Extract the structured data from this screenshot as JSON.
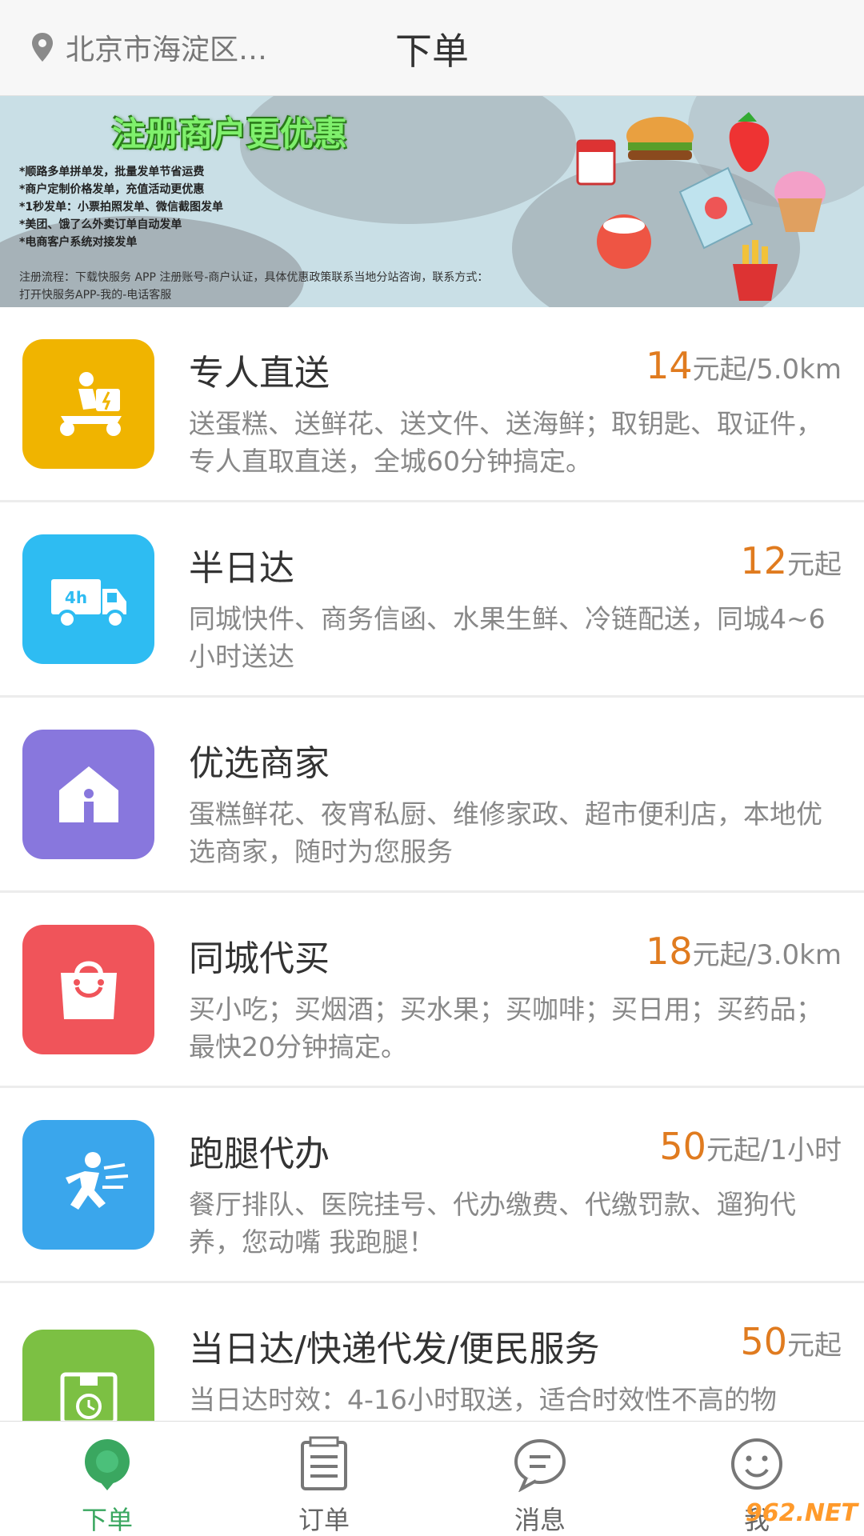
{
  "header": {
    "location": "北京市海淀区…",
    "title": "下单"
  },
  "banner": {
    "headline": "注册商户更优惠",
    "bullets": [
      "*顺路多单拼单发，批量发单节省运费",
      "*商户定制价格发单，充值活动更优惠",
      "*1秒发单：小票拍照发单、微信截图发单",
      "*美团、饿了么外卖订单自动发单",
      "*电商客户系统对接发单"
    ],
    "footer": [
      "注册流程：下载快服务 APP 注册账号-商户认证，具体优惠政策联系当地分站咨询，联系方式：",
      "打开快服务APP-我的-电话客服"
    ]
  },
  "services": [
    {
      "name": "专人直送",
      "price_num": "14",
      "price_unit": "元起/5.0km",
      "desc": "送蛋糕、送鲜花、送文件、送海鲜；取钥匙、取证件，专人直取直送，全城60分钟搞定。",
      "icon": "scooter-icon",
      "color": "#f0b400"
    },
    {
      "name": "半日达",
      "price_num": "12",
      "price_unit": "元起",
      "desc": "同城快件、商务信函、水果生鲜、冷链配送，同城4~6小时送达",
      "icon": "truck-4h-icon",
      "color": "#2ebcf2"
    },
    {
      "name": "优选商家",
      "price_num": "",
      "price_unit": "",
      "desc": "蛋糕鲜花、夜宵私厨、维修家政、超市便利店，本地优选商家，随时为您服务",
      "icon": "house-icon",
      "color": "#8877dd"
    },
    {
      "name": "同城代买",
      "price_num": "18",
      "price_unit": "元起/3.0km",
      "desc": "买小吃；买烟酒；买水果；买咖啡；买日用；买药品；最快20分钟搞定。",
      "icon": "shopping-bag-icon",
      "color": "#f0545a"
    },
    {
      "name": "跑腿代办",
      "price_num": "50",
      "price_unit": "元起/1小时",
      "desc": "餐厅排队、医院挂号、代办缴费、代缴罚款、遛狗代养，您动嘴 我跑腿！",
      "icon": "runner-icon",
      "color": "#3aa6ec"
    },
    {
      "name": "当日达/快递代发/便民服务",
      "price_num": "50",
      "price_unit": "元起",
      "desc": "当日达时效：4-16小时取送，适合时效性不高的物",
      "icon": "clock-box-icon",
      "color": "#7cc043"
    }
  ],
  "nav": [
    {
      "label": "下单",
      "icon": "location-pin-icon",
      "active": true
    },
    {
      "label": "订单",
      "icon": "order-list-icon",
      "active": false
    },
    {
      "label": "消息",
      "icon": "chat-bubble-icon",
      "active": false
    },
    {
      "label": "我",
      "icon": "smiley-icon",
      "active": false
    }
  ],
  "watermark": "962.NET",
  "colors": {
    "accent_green": "#3aa760",
    "price_orange": "#e07b1f",
    "banner_green": "#7ff06c"
  }
}
